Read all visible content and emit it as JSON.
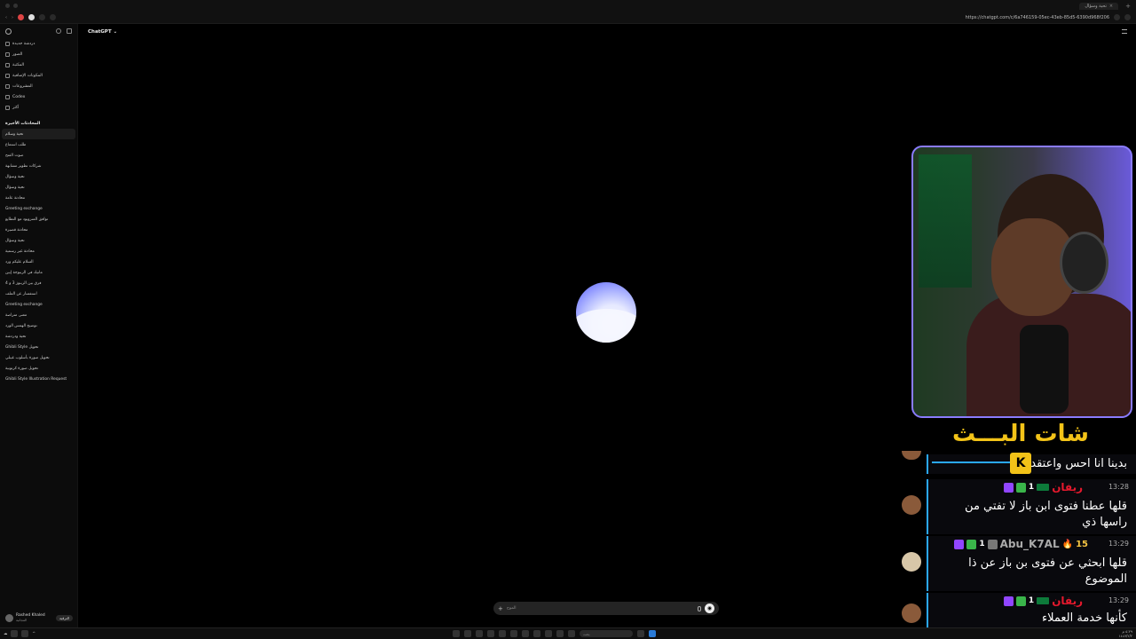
{
  "browser": {
    "tab_title": "تحية وسؤال",
    "url": "https://chatgpt.com/c/6a746159-05ec-43eb-85d5-6390d968f206"
  },
  "sidebar": {
    "nav": [
      {
        "label": "دردشة جديدة",
        "icon": "new-chat-icon"
      },
      {
        "label": "الصور",
        "icon": "images-icon"
      },
      {
        "label": "المكتبة",
        "icon": "library-icon"
      },
      {
        "label": "المكونات الإضافية",
        "icon": "plugins-icon"
      },
      {
        "label": "المشروعات",
        "icon": "projects-icon"
      },
      {
        "label": "Codex",
        "icon": "codex-icon"
      },
      {
        "label": "أكثر",
        "icon": "more-icon"
      }
    ],
    "section_title": "المحادثات الأخيرة",
    "conversations": [
      "تحية وسلام",
      "طلب استماع",
      "صوت الفتح",
      "شركات تطوير مشابهة",
      "تحية وسؤال",
      "تحية وسؤال",
      "محادثة عامة",
      "Greeting exchange",
      "توافق المنزوبود مع التطابع",
      "محادثة قصيرة",
      "تحية وسؤال",
      "محادثة غير رسمية",
      "السلام عليكم ورد",
      "مانيك في الرببوجة إبين",
      "فرق بين الرببوز 3 و 4",
      "استفسار عن الملف",
      "Greeting exchange",
      "معنى متراصة",
      "توضيح الهمس الورد",
      "تحية ودردشة",
      "Ghibli Style تحويل",
      "تحويل صورة بأسلوب غيبلي",
      "تحويل صورة كرتونية",
      "Ghibli Style Illustration Request"
    ],
    "user_name": "Rashed Khaled",
    "user_plan": "المجانية",
    "upgrade_label": "الترقية"
  },
  "main": {
    "model_label": "ChatGPT ⌄",
    "composer_placeholder": "الموح"
  },
  "taskbar": {
    "search_placeholder": "بحث",
    "time": "٥:٢٩ م",
    "date": "١٤٤٧/٢/٢"
  },
  "overlay": {
    "title": "شات البـــث"
  },
  "chat": {
    "messages": [
      {
        "text": "بدينا انا احس واعتقد"
      },
      {
        "time": "13:28",
        "badge_num": "1",
        "user": "ريفان",
        "text": "قلها عطنا فتوى ابن باز لا تفتي من راسها ذي"
      },
      {
        "time": "13:29",
        "badge_num": "1",
        "user": "Abu_K7AL",
        "count": "15",
        "text": "قلها ابحثي عن فتوى بن باز عن ذا الموضوع"
      },
      {
        "time": "13:29",
        "badge_num": "1",
        "user": "ريفان",
        "text": "كأنها خدمة العملاء"
      }
    ]
  }
}
